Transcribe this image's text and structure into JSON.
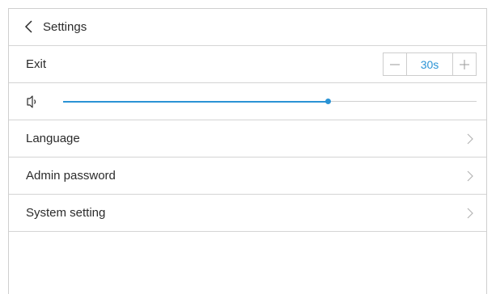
{
  "header": {
    "title": "Settings"
  },
  "exit": {
    "label": "Exit",
    "value": "30s"
  },
  "volume": {
    "level_fraction": 0.64,
    "accent_color": "#2a93d5"
  },
  "menu": [
    {
      "label": "Language"
    },
    {
      "label": "Admin password"
    },
    {
      "label": "System setting"
    }
  ]
}
